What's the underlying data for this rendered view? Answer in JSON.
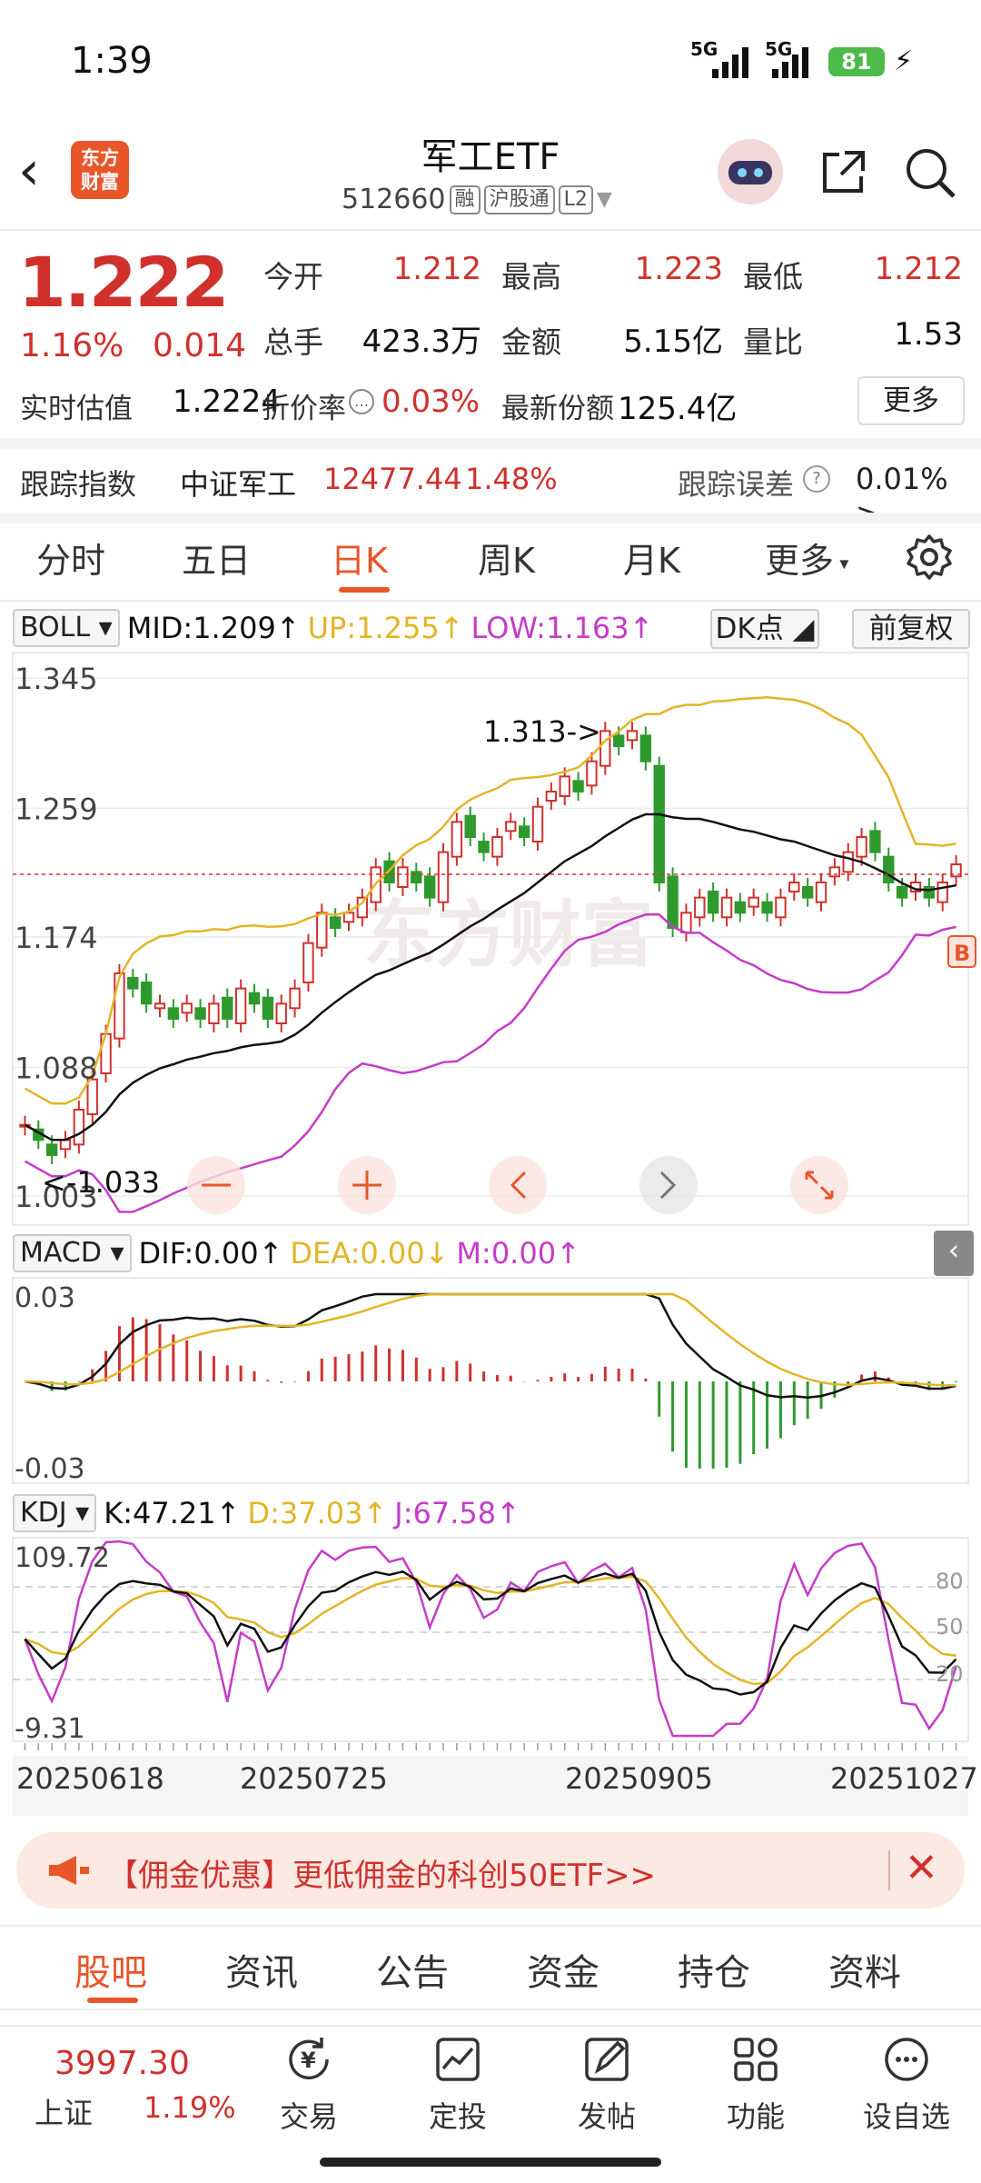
{
  "status_bar": {
    "time": "1:39",
    "signal1": "5G",
    "signal2": "5G",
    "battery": "81"
  },
  "header": {
    "logo_line1": "东方",
    "logo_line2": "财富",
    "title": "军工ETF",
    "code": "512660",
    "tags": [
      "融",
      "沪股通",
      "L2"
    ]
  },
  "quote": {
    "price": "1.222",
    "change_pct": "1.16%",
    "change_abs": "0.014",
    "fields": [
      {
        "label": "今开",
        "value": "1.212",
        "color": "#d0312d"
      },
      {
        "label": "最高",
        "value": "1.223",
        "color": "#d0312d"
      },
      {
        "label": "最低",
        "value": "1.212",
        "color": "#d0312d"
      },
      {
        "label": "总手",
        "value": "423.3万",
        "color": "#111111"
      },
      {
        "label": "金额",
        "value": "5.15亿",
        "color": "#111111"
      },
      {
        "label": "量比",
        "value": "1.53",
        "color": "#111111"
      }
    ],
    "est_label": "实时估值",
    "est_value": "1.2224",
    "discount_label": "折价率",
    "discount_value": "0.03%",
    "share_label": "最新份额",
    "share_value": "125.4亿",
    "more": "更多"
  },
  "tracking": {
    "label": "跟踪指数",
    "index_name": "中证军工",
    "index_value": "12477.44",
    "index_pct": "1.48%",
    "error_label": "跟踪误差",
    "error_value": "0.01% >"
  },
  "period_tabs": [
    "分时",
    "五日",
    "日K",
    "周K",
    "月K",
    "更多"
  ],
  "active_period": "日K",
  "boll": {
    "name": "BOLL",
    "mid": "MID:1.209",
    "up": "UP:1.255",
    "low": "LOW:1.163",
    "dk_button": "DK点",
    "adjust_button": "前复权",
    "y_ticks": [
      "1.345",
      "1.259",
      "1.174",
      "1.088",
      "1.003"
    ],
    "high_note": "1.313->",
    "low_note": "<-1.033",
    "watermark": "东方财富",
    "marker": "B"
  },
  "macd": {
    "name": "MACD",
    "dif": "DIF:0.00",
    "dea": "DEA:0.00",
    "m": "M:0.00",
    "y_top": "0.03",
    "y_bottom": "-0.03"
  },
  "kdj": {
    "name": "KDJ",
    "k": "K:47.21",
    "d": "D:37.03",
    "j": "J:67.58",
    "y_top": "109.72",
    "y_bottom": "-9.31",
    "right_ticks": [
      "80",
      "50",
      "20"
    ]
  },
  "dates": [
    "20250618",
    "20250725",
    "20250905",
    "20251027"
  ],
  "banner": {
    "text": "【佣金优惠】更低佣金的科创50ETF>>"
  },
  "content_tabs": [
    "股吧",
    "资讯",
    "公告",
    "资金",
    "持仓",
    "资料"
  ],
  "active_content_tab": "股吧",
  "footer": {
    "index_value": "3997.30",
    "index_name": "上证",
    "index_pct": "1.19%",
    "buttons": [
      "交易",
      "定投",
      "发帖",
      "功能",
      "设自选"
    ]
  },
  "colors": {
    "up": "#d0312d",
    "down": "#2e9a2e",
    "accent": "#e8562a",
    "boll_up": "#e3b526",
    "boll_low": "#c53cc9",
    "boll_mid": "#111111"
  },
  "chart_data": {
    "type": "candlestick",
    "x_range": [
      "20250610",
      "20251031"
    ],
    "ylim": [
      1.003,
      1.345
    ],
    "close_series": [
      1.05,
      1.04,
      1.03,
      1.04,
      1.06,
      1.08,
      1.11,
      1.15,
      1.14,
      1.13,
      1.13,
      1.12,
      1.13,
      1.12,
      1.13,
      1.12,
      1.14,
      1.13,
      1.12,
      1.13,
      1.14,
      1.17,
      1.19,
      1.18,
      1.19,
      1.2,
      1.22,
      1.21,
      1.22,
      1.21,
      1.2,
      1.23,
      1.25,
      1.24,
      1.23,
      1.24,
      1.25,
      1.24,
      1.26,
      1.27,
      1.28,
      1.27,
      1.29,
      1.31,
      1.3,
      1.31,
      1.29,
      1.21,
      1.18,
      1.19,
      1.2,
      1.19,
      1.2,
      1.19,
      1.2,
      1.19,
      1.2,
      1.21,
      1.2,
      1.21,
      1.22,
      1.23,
      1.24,
      1.23,
      1.21,
      1.2,
      1.21,
      1.2,
      1.21,
      1.222
    ],
    "boll_mid_last": 1.209,
    "boll_up_last": 1.255,
    "boll_low_last": 1.163,
    "macd_range": [
      -0.03,
      0.03
    ],
    "kdj_range": [
      -9.31,
      109.72
    ]
  }
}
